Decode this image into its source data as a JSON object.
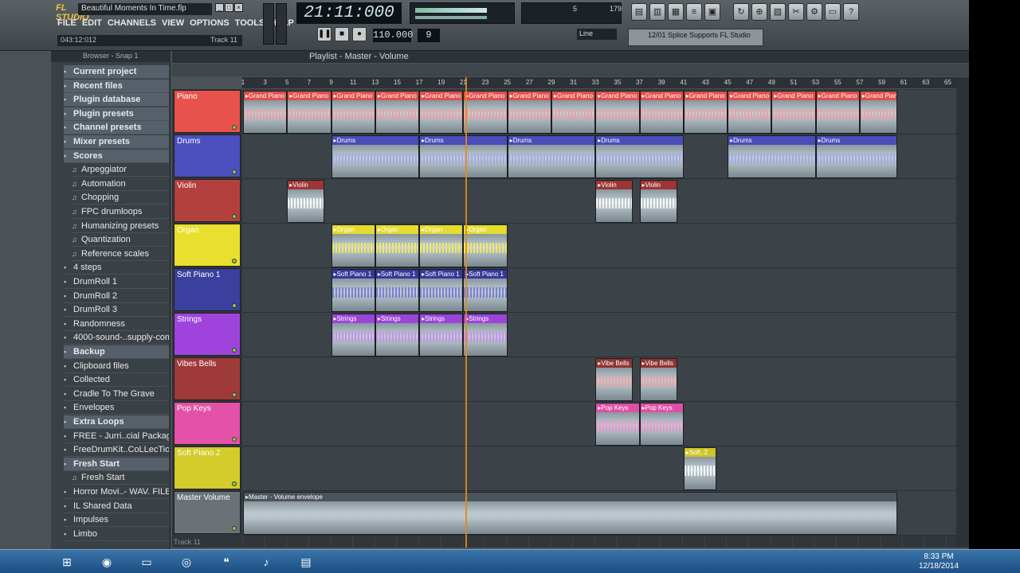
{
  "app": {
    "logo": "FL STUDIO",
    "song_title": "Beautiful Moments In Time.flp",
    "menu": [
      "FILE",
      "EDIT",
      "CHANNELS",
      "VIEW",
      "OPTIONS",
      "TOOLS",
      "HELP"
    ],
    "hint_left": "043:12:012",
    "hint_right": "Track 11",
    "time": "21:11:000",
    "tempo": "110.000",
    "pattern": "9",
    "snap": "Line",
    "news_panel": "12/01 Splice Supports FL Studio",
    "cpu_value": "5",
    "mem_value": "179"
  },
  "browser": {
    "header": "Browser - Snap 1",
    "items": [
      {
        "label": "Current project",
        "hl": true
      },
      {
        "label": "Recent files",
        "hl": true
      },
      {
        "label": "Plugin database",
        "hl": true
      },
      {
        "label": "Plugin presets",
        "hl": true
      },
      {
        "label": "Channel presets",
        "hl": true
      },
      {
        "label": "Mixer presets",
        "hl": true
      },
      {
        "label": "Scores",
        "hl": true
      },
      {
        "label": "Arpeggiator",
        "sub": true
      },
      {
        "label": "Automation",
        "sub": true
      },
      {
        "label": "Chopping",
        "sub": true
      },
      {
        "label": "FPC drumloops",
        "sub": true
      },
      {
        "label": "Humanizing presets",
        "sub": true
      },
      {
        "label": "Quantization",
        "sub": true
      },
      {
        "label": "Reference scales",
        "sub": true
      },
      {
        "label": "4 steps"
      },
      {
        "label": "DrumRoll 1"
      },
      {
        "label": "DrumRoll 2"
      },
      {
        "label": "DrumRoll 3"
      },
      {
        "label": "Randomness"
      },
      {
        "label": "4000-sound-..supply-com"
      },
      {
        "label": "Backup",
        "hl": true
      },
      {
        "label": "Clipboard files"
      },
      {
        "label": "Collected"
      },
      {
        "label": "Cradle To The Grave"
      },
      {
        "label": "Envelopes"
      },
      {
        "label": "Extra Loops",
        "hl": true
      },
      {
        "label": "FREE - Jurri..cial Package"
      },
      {
        "label": "FreeDrumKit..CoLLecTioN"
      },
      {
        "label": "Fresh Start",
        "hl": true
      },
      {
        "label": "Fresh Start",
        "sub": true
      },
      {
        "label": "Horror Movi..- WAV. FILES"
      },
      {
        "label": "IL Shared Data"
      },
      {
        "label": "Impulses"
      },
      {
        "label": "Limbo"
      }
    ]
  },
  "playlist": {
    "title": "Playlist - Master - Volume",
    "ruler": [
      1,
      3,
      5,
      7,
      9,
      11,
      13,
      15,
      17,
      19,
      21,
      23,
      25,
      27,
      29,
      31,
      33,
      35,
      37,
      39,
      41,
      43,
      45,
      47,
      49,
      51,
      53,
      55,
      57,
      59,
      61,
      63,
      65
    ],
    "tracks": [
      {
        "name": "Piano",
        "color": "#e8524d",
        "clipcolor": "#e0504d",
        "clips": [
          {
            "start": 1,
            "len": 4,
            "label": "Grand Piano"
          },
          {
            "start": 5,
            "len": 4,
            "label": "Grand Piano"
          },
          {
            "start": 9,
            "len": 4,
            "label": "Grand Piano"
          },
          {
            "start": 13,
            "len": 4,
            "label": "Grand Piano"
          },
          {
            "start": 17,
            "len": 4,
            "label": "Grand Piano"
          },
          {
            "start": 21,
            "len": 4,
            "label": "Grand Piano"
          },
          {
            "start": 25,
            "len": 4,
            "label": "Grand Piano"
          },
          {
            "start": 29,
            "len": 4,
            "label": "Grand Piano"
          },
          {
            "start": 33,
            "len": 4,
            "label": "Grand Piano"
          },
          {
            "start": 37,
            "len": 4,
            "label": "Grand Piano"
          },
          {
            "start": 41,
            "len": 4,
            "label": "Grand Piano"
          },
          {
            "start": 45,
            "len": 4,
            "label": "Grand Piano"
          },
          {
            "start": 49,
            "len": 4,
            "label": "Grand Piano"
          },
          {
            "start": 53,
            "len": 4,
            "label": "Grand Piano"
          },
          {
            "start": 57,
            "len": 4,
            "label": "Grand Piano"
          }
        ],
        "wave": "#f29a9a"
      },
      {
        "name": "Drums",
        "color": "#4c4fbf",
        "clipcolor": "#4a4db8",
        "clips": [
          {
            "start": 9,
            "len": 8,
            "label": "Drums"
          },
          {
            "start": 17,
            "len": 8,
            "label": "Drums"
          },
          {
            "start": 25,
            "len": 8,
            "label": "Drums"
          },
          {
            "start": 33,
            "len": 8,
            "label": "Drums"
          },
          {
            "start": 45,
            "len": 8,
            "label": "Drums"
          },
          {
            "start": 53,
            "len": 8,
            "label": "Drums"
          }
        ],
        "wave": "#9ea6e8"
      },
      {
        "name": "Violin",
        "color": "#b3403f",
        "clipcolor": "#9e3535",
        "clips": [
          {
            "start": 5,
            "len": 3.4,
            "label": "Violin"
          },
          {
            "start": 33,
            "len": 3.4,
            "label": "Violin"
          },
          {
            "start": 37,
            "len": 3.4,
            "label": "Violin"
          }
        ],
        "wave": "#ffffff"
      },
      {
        "name": "Organ",
        "color": "#e9df2e",
        "clipcolor": "#e5dc2e",
        "clips": [
          {
            "start": 9,
            "len": 4,
            "label": "Organ"
          },
          {
            "start": 13,
            "len": 4,
            "label": "Organ"
          },
          {
            "start": 17,
            "len": 4,
            "label": "Organ"
          },
          {
            "start": 21,
            "len": 4,
            "label": "Organ"
          }
        ],
        "wave": "#f6ee55"
      },
      {
        "name": "Soft Piano 1",
        "color": "#3b3f9e",
        "clipcolor": "#36399a",
        "clips": [
          {
            "start": 9,
            "len": 4,
            "label": "Soft Piano 1"
          },
          {
            "start": 13,
            "len": 4,
            "label": "Soft Piano 1"
          },
          {
            "start": 17,
            "len": 4,
            "label": "Soft Piano 1"
          },
          {
            "start": 21,
            "len": 4,
            "label": "Soft Piano 1"
          }
        ],
        "wave": "#6c74d8"
      },
      {
        "name": "Strings",
        "color": "#9e44dd",
        "clipcolor": "#9a45d8",
        "clips": [
          {
            "start": 9,
            "len": 4,
            "label": "Strings"
          },
          {
            "start": 13,
            "len": 4,
            "label": "Strings"
          },
          {
            "start": 17,
            "len": 4,
            "label": "Strings"
          },
          {
            "start": 21,
            "len": 4,
            "label": "Strings"
          }
        ],
        "wave": "#c48af0"
      },
      {
        "name": "Vibes Bells",
        "color": "#9e3a3a",
        "clipcolor": "#8f3333",
        "clips": [
          {
            "start": 33,
            "len": 3.4,
            "label": "Vibe Bells"
          },
          {
            "start": 37,
            "len": 3.4,
            "label": "Vibe Bells"
          }
        ],
        "wave": "#f19a9a"
      },
      {
        "name": "Pop Keys",
        "color": "#e352a8",
        "clipcolor": "#df4fa4",
        "clips": [
          {
            "start": 33,
            "len": 4,
            "label": "Pop Keys"
          },
          {
            "start": 37,
            "len": 4,
            "label": "Pop Keys"
          }
        ],
        "wave": "#f28bcb"
      },
      {
        "name": "Soft Piano 2",
        "color": "#d3cc2a",
        "clipcolor": "#cec628",
        "clips": [
          {
            "start": 41,
            "len": 3,
            "label": "Soft..2"
          }
        ],
        "wave": "#ffffff"
      },
      {
        "name": "Master Volume",
        "color": "#6a7277",
        "clipcolor": "#4b545a",
        "clips": [
          {
            "start": 1,
            "len": 60,
            "label": "Master - Volume envelope"
          }
        ],
        "wave": "#b8c3c9"
      }
    ],
    "last_track": "Track 11",
    "playhead_bar": 21.2
  },
  "taskbar": {
    "time": "8:33 PM",
    "date": "12/18/2014",
    "apps": [
      "start-orb",
      "chrome",
      "explorer",
      "firefox",
      "hangouts",
      "fl-studio",
      "file-manager"
    ]
  }
}
